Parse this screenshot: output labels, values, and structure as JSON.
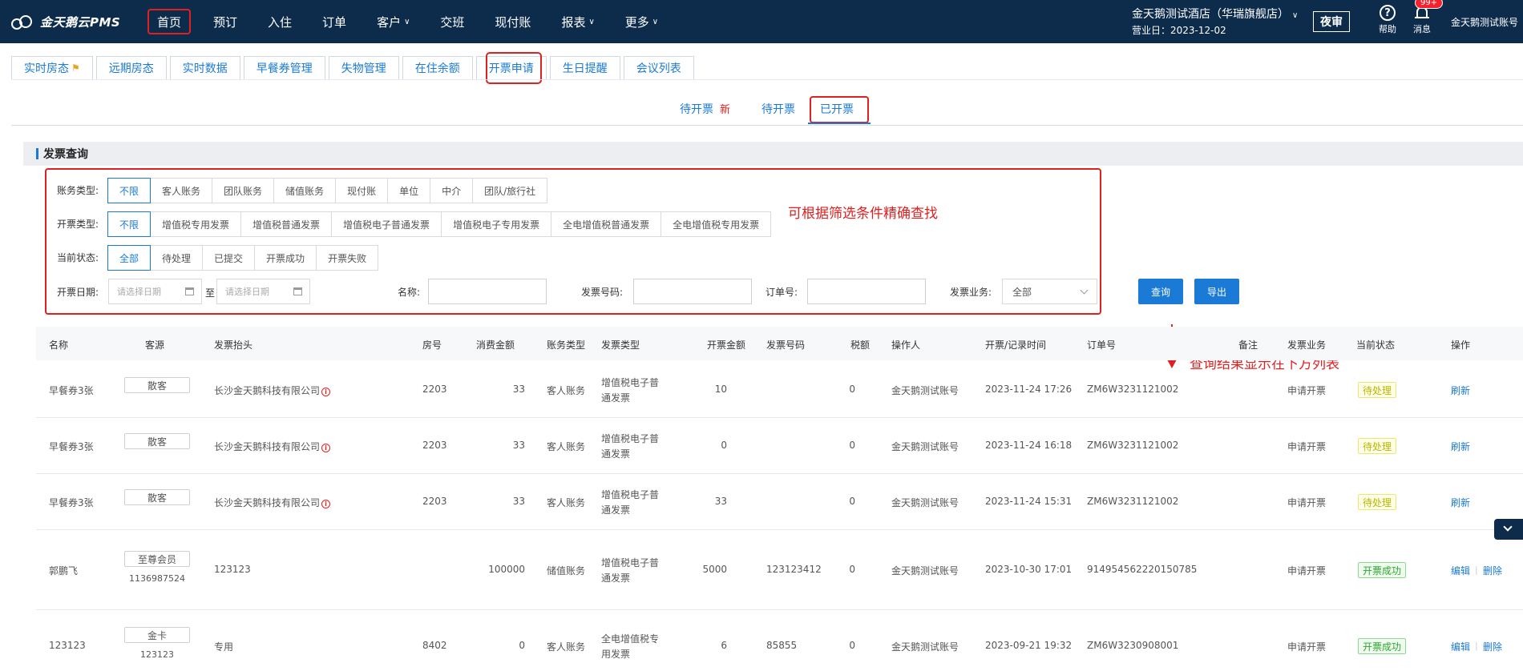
{
  "app": {
    "logo_text": "金天鹅云PMS"
  },
  "nav": [
    {
      "label": "首页",
      "active": true,
      "caret": false
    },
    {
      "label": "预订",
      "caret": false
    },
    {
      "label": "入住",
      "caret": false
    },
    {
      "label": "订单",
      "caret": false
    },
    {
      "label": "客户",
      "caret": true
    },
    {
      "label": "交班",
      "caret": false
    },
    {
      "label": "现付账",
      "caret": false
    },
    {
      "label": "报表",
      "caret": true
    },
    {
      "label": "更多",
      "caret": true
    }
  ],
  "header": {
    "hotel_name": "金天鹅测试酒店（华瑞旗舰店）",
    "business_day": "营业日：2023-12-02",
    "night_audit": "夜审",
    "help": "帮助",
    "messages": "消息",
    "badge": "99+",
    "user": "金天鹅测试账号"
  },
  "tabs": [
    "实时房态",
    "远期房态",
    "实时数据",
    "早餐券管理",
    "失物管理",
    "在住余额",
    "开票申请",
    "生日提醒",
    "会议列表"
  ],
  "subtabs": {
    "pending": "待开票",
    "new_tag": "新",
    "pending2": "待开票",
    "done": "已开票"
  },
  "section_title": "发票查询",
  "filters": {
    "account_type": {
      "label": "账务类型:",
      "options": [
        "不限",
        "客人账务",
        "团队账务",
        "储值账务",
        "现付账",
        "单位",
        "中介",
        "团队/旅行社"
      ],
      "selected": 0
    },
    "invoice_type": {
      "label": "开票类型:",
      "options": [
        "不限",
        "增值税专用发票",
        "增值税普通发票",
        "增值税电子普通发票",
        "增值税电子专用发票",
        "全电增值税普通发票",
        "全电增值税专用发票"
      ],
      "selected": 0
    },
    "status": {
      "label": "当前状态:",
      "options": [
        "全部",
        "待处理",
        "已提交",
        "开票成功",
        "开票失败"
      ],
      "selected": 0
    },
    "date": {
      "label": "开票日期:",
      "start_placeholder": "请选择日期",
      "to": "至",
      "end_placeholder": "请选择日期"
    },
    "name": {
      "label": "名称:",
      "value": ""
    },
    "invoice_no": {
      "label": "发票号码:",
      "value": ""
    },
    "order_no": {
      "label": "订单号:",
      "value": ""
    },
    "business": {
      "label": "发票业务:",
      "value": "全部"
    },
    "search": "查询",
    "export": "导出"
  },
  "annotations": {
    "filter_note": "可根据筛选条件精确查找",
    "result_note": "查询结果显示在下方列表"
  },
  "table": {
    "headers": [
      "名称",
      "客源",
      "发票抬头",
      "房号",
      "消费金额",
      "账务类型",
      "发票类型",
      "开票金额",
      "发票号码",
      "税额",
      "操作人",
      "开票/记录时间",
      "订单号",
      "备注",
      "发票业务",
      "当前状态",
      "操作"
    ],
    "rows": [
      {
        "name": "早餐券3张",
        "source": "散客",
        "source_sub": "",
        "title": "长沙金天鹅科技有限公司",
        "title_warn": true,
        "room": "2203",
        "consume": "33",
        "acct": "客人账务",
        "inv_type_1": "增值税电子普",
        "inv_type_2": "通发票",
        "inv_amount": "10",
        "inv_no": "",
        "tax": "0",
        "operator": "金天鹅测试账号",
        "time": "2023-11-24 17:26",
        "order": "ZM6W3231121002",
        "remark": "",
        "biz": "申请开票",
        "status": "待处理",
        "status_kind": "pending",
        "actions": [
          "刷新"
        ]
      },
      {
        "name": "早餐券3张",
        "source": "散客",
        "source_sub": "",
        "title": "长沙金天鹅科技有限公司",
        "title_warn": true,
        "room": "2203",
        "consume": "33",
        "acct": "客人账务",
        "inv_type_1": "增值税电子普",
        "inv_type_2": "通发票",
        "inv_amount": "0",
        "inv_no": "",
        "tax": "0",
        "operator": "金天鹅测试账号",
        "time": "2023-11-24 16:18",
        "order": "ZM6W3231121002",
        "remark": "",
        "biz": "申请开票",
        "status": "待处理",
        "status_kind": "pending",
        "actions": [
          "刷新"
        ]
      },
      {
        "name": "早餐券3张",
        "source": "散客",
        "source_sub": "",
        "title": "长沙金天鹅科技有限公司",
        "title_warn": true,
        "room": "2203",
        "consume": "33",
        "acct": "客人账务",
        "inv_type_1": "增值税电子普",
        "inv_type_2": "通发票",
        "inv_amount": "33",
        "inv_no": "",
        "tax": "0",
        "operator": "金天鹅测试账号",
        "time": "2023-11-24 15:31",
        "order": "ZM6W3231121002",
        "remark": "",
        "biz": "申请开票",
        "status": "待处理",
        "status_kind": "pending",
        "actions": [
          "刷新"
        ]
      },
      {
        "name": "郭鹏飞",
        "source": "至尊会员",
        "source_sub": "1136987524",
        "title": "123123",
        "title_warn": false,
        "room": "",
        "consume": "100000",
        "acct": "储值账务",
        "inv_type_1": "增值税电子普",
        "inv_type_2": "通发票",
        "inv_amount": "5000",
        "inv_no": "123123412",
        "tax": "0",
        "operator": "金天鹅测试账号",
        "time": "2023-10-30 17:01",
        "order": "914954562220150785",
        "remark": "",
        "biz": "申请开票",
        "status": "开票成功",
        "status_kind": "ok",
        "actions": [
          "编辑",
          "删除"
        ]
      },
      {
        "name": "123123",
        "source": "金卡",
        "source_sub": "123123",
        "title": "专用",
        "title_warn": false,
        "room": "8402",
        "consume": "0",
        "acct": "客人账务",
        "inv_type_1": "全电增值税专",
        "inv_type_2": "用发票",
        "inv_amount": "6",
        "inv_no": "85855",
        "tax": "0",
        "operator": "金天鹅测试账号",
        "time": "2023-09-21 19:32",
        "order": "ZM6W3230908001",
        "remark": "",
        "biz": "申请开票",
        "status": "开票成功",
        "status_kind": "ok",
        "actions": [
          "编辑",
          "删除"
        ]
      }
    ]
  }
}
